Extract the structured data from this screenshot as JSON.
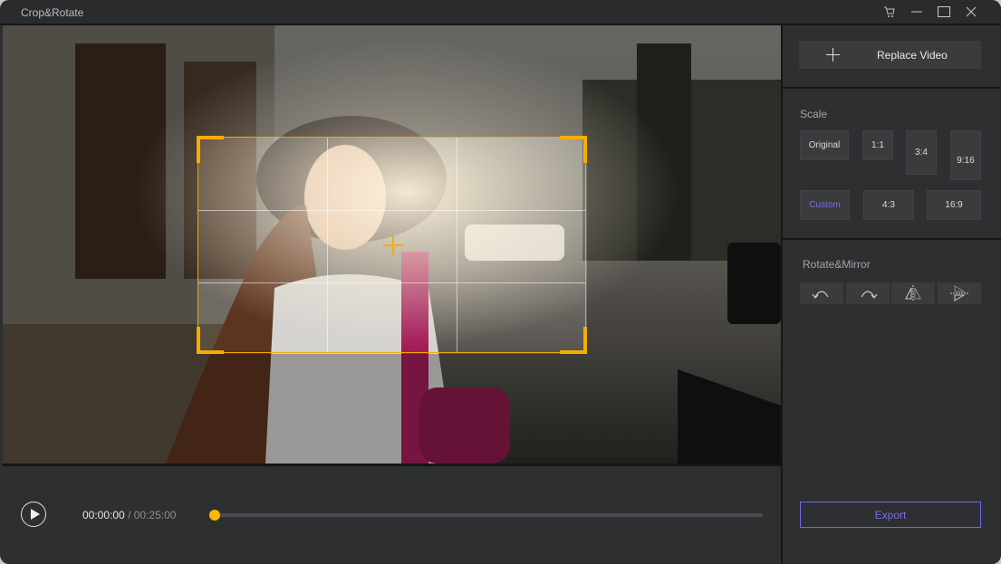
{
  "window": {
    "title": "Crop&Rotate",
    "controls": [
      {
        "name": "cart",
        "icon": "cart-icon"
      },
      {
        "name": "minimize",
        "icon": "minimize-icon"
      },
      {
        "name": "maximize",
        "icon": "maximize-icon"
      },
      {
        "name": "close",
        "icon": "close-icon"
      }
    ]
  },
  "preview": {
    "crop_box": {
      "accent_color": "#f5ae00",
      "grid": "3x3"
    }
  },
  "player": {
    "current_time": "00:00:00",
    "separator": "/",
    "duration": "00:25:00",
    "progress": 0,
    "accent_color": "#ffb800"
  },
  "sidebar": {
    "replace_video_label": "Replace Video",
    "scale": {
      "label": "Scale",
      "options": [
        "Original",
        "1:1",
        "3:4",
        "9:16",
        "Custom",
        "4:3",
        "16:9"
      ],
      "selected": "Custom"
    },
    "rotate_mirror": {
      "label": "Rotate&Mirror",
      "actions": [
        {
          "name": "rotate-left",
          "icon": "rotate-left-icon"
        },
        {
          "name": "rotate-right",
          "icon": "rotate-right-icon"
        },
        {
          "name": "flip-horizontal",
          "icon": "flip-horizontal-icon"
        },
        {
          "name": "flip-vertical",
          "icon": "flip-vertical-icon"
        }
      ]
    },
    "export_label": "Export",
    "accent_color": "#7a6cf0"
  }
}
